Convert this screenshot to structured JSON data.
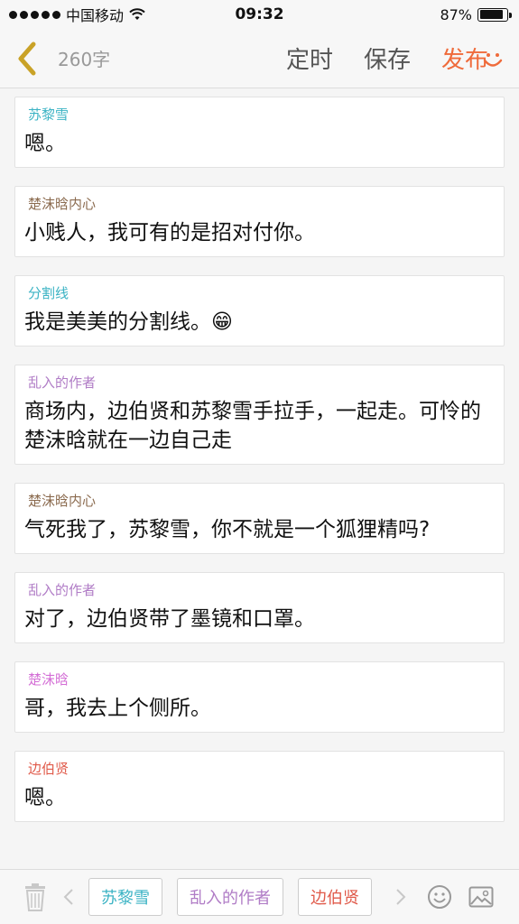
{
  "status_bar": {
    "carrier": "中国移动",
    "time": "09:32",
    "battery": "87%",
    "battery_level": 0.87
  },
  "header": {
    "word_count": "260字",
    "timer_label": "定时",
    "save_label": "保存",
    "publish_label": "发布"
  },
  "colors": {
    "accent": "#ef6b3b",
    "back_arrow": "#c9a227"
  },
  "messages": [
    {
      "speaker": "苏黎雪",
      "speaker_color": "#3bb3c4",
      "text": "嗯。"
    },
    {
      "speaker": "楚沫晗内心",
      "speaker_color": "#8b6b4f",
      "text": "小贱人，我可有的是招对付你。"
    },
    {
      "speaker": "分割线",
      "speaker_color": "#3bb3c4",
      "text": "我是美美的分割线。😁"
    },
    {
      "speaker": "乱入的作者",
      "speaker_color": "#b07cc6",
      "text": "商场内，边伯贤和苏黎雪手拉手，一起走。可怜的楚沫晗就在一边自己走"
    },
    {
      "speaker": "楚沫晗内心",
      "speaker_color": "#8b6b4f",
      "text": "气死我了，苏黎雪，你不就是一个狐狸精吗?"
    },
    {
      "speaker": "乱入的作者",
      "speaker_color": "#b07cc6",
      "text": "对了，边伯贤带了墨镜和口罩。"
    },
    {
      "speaker": "楚沫晗",
      "speaker_color": "#d46fd6",
      "text": "哥，我去上个侧所。"
    },
    {
      "speaker": "边伯贤",
      "speaker_color": "#e05a4a",
      "text": "嗯。"
    }
  ],
  "toolbar": {
    "tags": [
      {
        "label": "苏黎雪",
        "color": "#3bb3c4"
      },
      {
        "label": "乱入的作者",
        "color": "#b07cc6"
      },
      {
        "label": "边伯贤",
        "color": "#e05a4a"
      }
    ],
    "icons": [
      "trash-icon",
      "chevron-left-icon",
      "chevron-right-icon",
      "emoji-icon",
      "image-icon"
    ]
  }
}
